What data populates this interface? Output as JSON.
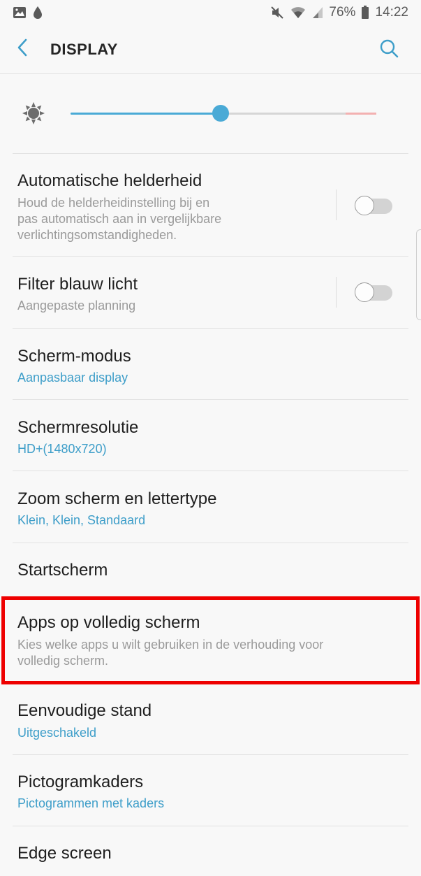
{
  "status_bar": {
    "battery": "76%",
    "time": "14:22",
    "icons": [
      "image-icon",
      "drop-icon",
      "mute-icon",
      "wifi-icon",
      "signal-icon",
      "battery-icon"
    ]
  },
  "app_bar": {
    "title": "DISPLAY",
    "back_icon": "chevron-left-icon",
    "search_icon": "search-icon"
  },
  "brightness": {
    "icon": "sun-icon",
    "level": 0.49,
    "accent": "#4aaad6",
    "warning_color": "#f3b1b1"
  },
  "settings": [
    {
      "title": "Automatische helderheid",
      "subtitle": "Houd de helderheidinstelling bij en pas automatisch aan in vergelijkbare verlichtingsomstandigheden.",
      "subtitle_lines": [
        "Houd de helderheidinstelling bij en",
        "pas automatisch aan in vergelijkbare",
        "verlichtingsomstandigheden."
      ],
      "subtitle_style": "gray",
      "toggle": false
    },
    {
      "title": "Filter blauw licht",
      "subtitle": "Aangepaste planning",
      "subtitle_style": "gray",
      "toggle": false
    },
    {
      "title": "Scherm-modus",
      "subtitle": "Aanpasbaar display",
      "subtitle_style": "blue"
    },
    {
      "title": "Schermresolutie",
      "subtitle": "HD+(1480x720)",
      "subtitle_style": "blue"
    },
    {
      "title": "Zoom scherm en lettertype",
      "subtitle": "Klein, Klein, Standaard",
      "subtitle_style": "blue"
    },
    {
      "title": "Startscherm"
    },
    {
      "title": "Apps op volledig scherm",
      "subtitle": "Kies welke apps u wilt gebruiken in de verhouding voor volledig scherm.",
      "subtitle_lines": [
        "Kies welke apps u wilt gebruiken in de verhouding voor",
        "volledig scherm."
      ],
      "subtitle_style": "gray",
      "highlighted": true
    },
    {
      "title": "Eenvoudige stand",
      "subtitle": "Uitgeschakeld",
      "subtitle_style": "blue"
    },
    {
      "title": "Pictogramkaders",
      "subtitle": "Pictogrammen met kaders",
      "subtitle_style": "blue"
    },
    {
      "title": "Edge screen"
    }
  ],
  "colors": {
    "background": "#f8f8f8",
    "blue_text": "#3e9ec9",
    "highlight": "#ee0000"
  }
}
